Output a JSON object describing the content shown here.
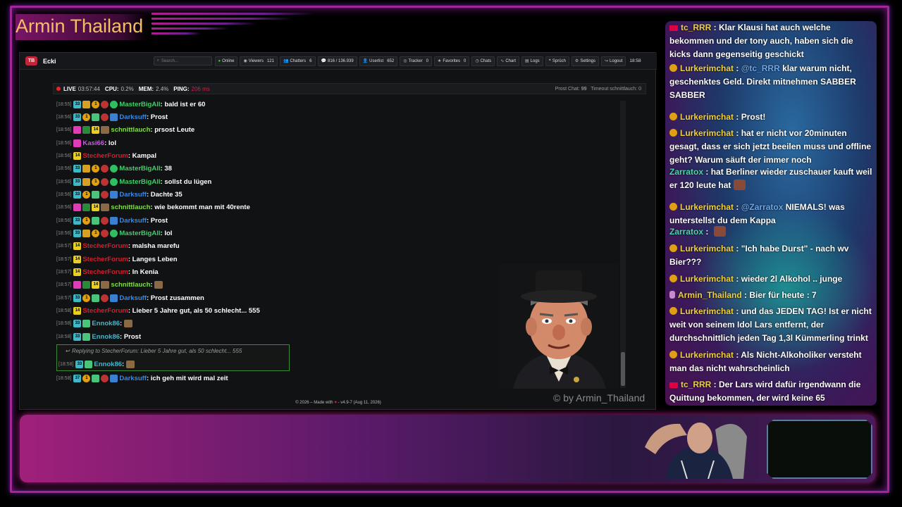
{
  "stream": {
    "title": "Armin Thailand"
  },
  "app": {
    "logo": "TB",
    "name": "Ecki",
    "search_placeholder": "Search...",
    "buttons": [
      {
        "icon": "globe-icon",
        "label": "Online"
      },
      {
        "icon": "eye-icon",
        "label": "Viewers",
        "count": "121"
      },
      {
        "icon": "users-icon",
        "label": "Chatters",
        "count": "6"
      },
      {
        "icon": "chat-icon",
        "label": "816 / 136.939"
      },
      {
        "icon": "user-icon",
        "label": "Userlist",
        "count": "652"
      },
      {
        "icon": "target-icon",
        "label": "Tracker",
        "count": "0"
      },
      {
        "icon": "star-icon",
        "label": "Favorites",
        "count": "0"
      },
      {
        "icon": "clock-icon",
        "label": "Chats"
      },
      {
        "icon": "chart-icon",
        "label": "Chart"
      },
      {
        "icon": "file-icon",
        "label": "Logs"
      },
      {
        "icon": "speech-icon",
        "label": "Sprüch"
      },
      {
        "icon": "gear-icon",
        "label": "Settings"
      },
      {
        "icon": "logout-icon",
        "label": "Logout"
      }
    ],
    "clock": "18:58",
    "status": {
      "live_label": "LIVE",
      "live_time": "03:57:44",
      "cpu_label": "CPU:",
      "cpu": "0.2%",
      "mem_label": "MEM:",
      "mem": "2.4%",
      "ping_label": "PING:",
      "ping": "206 ms",
      "prost_label": "Prost Chat:",
      "prost": "99",
      "timeout_label": "Timeout schnittlauch:",
      "timeout": "0"
    },
    "messages": [
      {
        "time": "[18:55]",
        "badges": [
          "sub",
          "crown",
          "coin",
          "flag",
          "green"
        ],
        "user": "MasterBigAll",
        "color": "#3fd068",
        "text": "bald ist er 60"
      },
      {
        "time": "[18:56]",
        "badges": [
          "sub",
          "coin",
          "gift",
          "flag",
          "blue"
        ],
        "user": "Darksuff",
        "color": "#3a8ae0",
        "text": "Prost"
      },
      {
        "time": "[18:56]",
        "badges": [
          "pink",
          "mod",
          "yellow",
          "emote"
        ],
        "user": "schnittlauch",
        "color": "#7ee040",
        "text": "prsost Leute"
      },
      {
        "time": "[18:56]",
        "badges": [
          "pink"
        ],
        "user": "Kasi66",
        "color": "#c060e0",
        "text": "lol"
      },
      {
        "time": "[18:56]",
        "badges": [
          "yellow"
        ],
        "user": "StecherForum",
        "color": "#d02030",
        "text": "Kampal"
      },
      {
        "time": "[18:56]",
        "badges": [
          "sub",
          "crown",
          "coin",
          "flag",
          "green"
        ],
        "user": "MasterBigAll",
        "color": "#3fd068",
        "text": "38"
      },
      {
        "time": "[18:56]",
        "badges": [
          "sub",
          "crown",
          "coin",
          "flag",
          "green"
        ],
        "user": "MasterBigAll",
        "color": "#3fd068",
        "text": "sollst du lügen"
      },
      {
        "time": "[18:56]",
        "badges": [
          "sub",
          "coin",
          "gift",
          "flag",
          "blue"
        ],
        "user": "Darksuff",
        "color": "#3a8ae0",
        "text": "Dachte 35"
      },
      {
        "time": "[18:56]",
        "badges": [
          "pink",
          "mod",
          "yellow",
          "emote"
        ],
        "user": "schnittlauch",
        "color": "#7ee040",
        "text": "wie bekommt man mit 40rente"
      },
      {
        "time": "[18:56]",
        "badges": [
          "sub",
          "coin",
          "gift",
          "flag",
          "blue"
        ],
        "user": "Darksuff",
        "color": "#3a8ae0",
        "text": "Prost"
      },
      {
        "time": "[18:56]",
        "badges": [
          "sub",
          "crown",
          "coin",
          "flag",
          "green"
        ],
        "user": "MasterBigAll",
        "color": "#3fd068",
        "text": "lol"
      },
      {
        "time": "[18:57]",
        "badges": [
          "yellow"
        ],
        "user": "StecherForum",
        "color": "#d02030",
        "text": "malsha marefu"
      },
      {
        "time": "[18:57]",
        "badges": [
          "yellow"
        ],
        "user": "StecherForum",
        "color": "#d02030",
        "text": "Langes Leben"
      },
      {
        "time": "[18:57]",
        "badges": [
          "yellow"
        ],
        "user": "StecherForum",
        "color": "#d02030",
        "text": "In Kenia"
      },
      {
        "time": "[18:57]",
        "badges": [
          "pink",
          "mod",
          "yellow",
          "emote"
        ],
        "user": "schnittlauch",
        "color": "#7ee040",
        "text": ""
      },
      {
        "time": "[18:57]",
        "badges": [
          "sub",
          "coin",
          "gift",
          "flag",
          "blue"
        ],
        "user": "Darksuff",
        "color": "#3a8ae0",
        "text": "Prost zusammen"
      },
      {
        "time": "[18:58]",
        "badges": [
          "yellow"
        ],
        "user": "StecherForum",
        "color": "#d02030",
        "text": "Lieber 5 Jahre gut, als 50 schlecht... 555"
      },
      {
        "time": "[18:58]",
        "badges": [
          "sub",
          "gift"
        ],
        "user": "Ennok86",
        "color": "#3fb8d0",
        "text": ""
      },
      {
        "time": "[18:58]",
        "badges": [
          "sub",
          "gift"
        ],
        "user": "Ennok86",
        "color": "#3fb8d0",
        "text": "Prost"
      }
    ],
    "reply": {
      "header": "Replying to StecherForum: Lieber 5 Jahre gut, als 50 schlecht... 555",
      "time": "[18:58]",
      "user": "Ennok86",
      "color": "#3fb8d0"
    },
    "last_message": {
      "time": "[18:58]",
      "user": "Darksuff",
      "color": "#3a8ae0",
      "text": "ich geh mit wird mal zeit"
    },
    "footer": {
      "prefix": "© 2026 – Made with",
      "suffix": "- v4.9-7 (Aug 11, 2026)"
    }
  },
  "watermark": "© by Armin_Thailand",
  "overlay_chat": [
    {
      "badge": "flag",
      "user": "tc_RRR",
      "color": "#f0d040",
      "text": "Klar Klausi hat auch welche bekommen und der tony auch, haben sich die kicks dann gegenseitig geschickt"
    },
    {
      "badge": "coin",
      "user": "Lurkerimchat",
      "color": "#f0d040",
      "mention": "@tc_RRR",
      "text": "klar warum nicht, geschenktes Geld. Direkt mitnehmen SABBER SABBER"
    },
    {
      "badge": "coin",
      "user": "Lurkerimchat",
      "color": "#f0d040",
      "text": "Prost!"
    },
    {
      "badge": "coin",
      "user": "Lurkerimchat",
      "color": "#f0d040",
      "text": "hat er nicht vor 20minuten gesagt, dass er sich jetzt beeilen muss und offline geht? Warum säuft der immer noch"
    },
    {
      "badge": "",
      "user": "Zarratox",
      "color": "#4ad8a8",
      "text": "hat Berliner wieder zuschauer kauft weil er 120 leute hat"
    },
    {
      "badge": "coin",
      "user": "Lurkerimchat",
      "color": "#f0d040",
      "mention": "@Zarratox",
      "text": "NIEMALS! was unterstellst du dem Kappa"
    },
    {
      "badge": "",
      "user": "Zarratox",
      "color": "#4ad8a8",
      "text": ""
    },
    {
      "badge": "coin",
      "user": "Lurkerimchat",
      "color": "#f0d040",
      "text": "\"Ich habe Durst\" - nach wv Bier???"
    },
    {
      "badge": "coin",
      "user": "Lurkerimchat",
      "color": "#f0d040",
      "text": "wieder 2l Alkohol .. junge"
    },
    {
      "badge": "mic",
      "user": "Armin_Thailand",
      "color": "#f0d040",
      "text": "Bier für heute : 7"
    },
    {
      "badge": "coin",
      "user": "Lurkerimchat",
      "color": "#f0d040",
      "text": "und das JEDEN TAG! Ist er nicht weit von seinem Idol Lars entfernt, der durchschnittlich jeden Tag 1,3l Kümmerling trinkt"
    },
    {
      "badge": "coin",
      "user": "Lurkerimchat",
      "color": "#f0d040",
      "text": "Als Nicht-Alkoholiker versteht man das nicht wahrscheinlich"
    },
    {
      "badge": "flag",
      "user": "tc_RRR",
      "color": "#f0d040",
      "text": "Der Lars wird dafür irgendwann die Quittung bekommen, der wird keine 65"
    }
  ]
}
